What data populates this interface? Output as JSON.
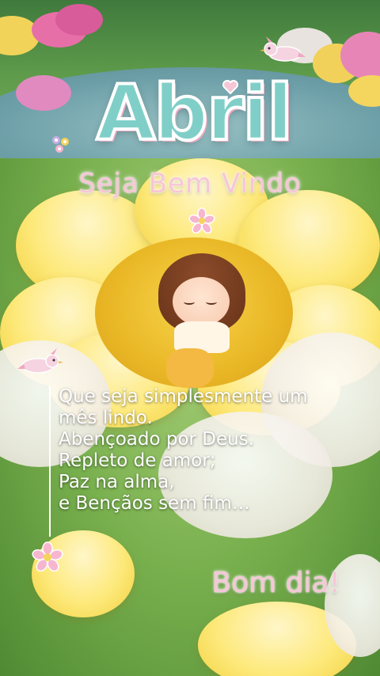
{
  "image": {
    "scene_description": "girl-sleeping-on-yellow-flower-in-meadow",
    "colors": {
      "title_fill": "#7fcfc8",
      "title_outline": "#ffffff",
      "accent_pink": "#f7c6d6",
      "flower_yellow": "#fde97a",
      "grass_green": "#79b04e"
    }
  },
  "header": {
    "title": "Abril",
    "subtitle": "Seja Bem Vindo"
  },
  "message": {
    "lines": [
      "Que seja simplesmente um",
      "mês lindo.",
      "Abençoado por Deus.",
      "Repleto de amor;",
      "Paz na alma,",
      "e Bençãos sem fim…"
    ]
  },
  "greeting": "Bom dia!",
  "decorations": {
    "icons": [
      "bird-icon",
      "flower-icon",
      "heart-icon"
    ]
  }
}
